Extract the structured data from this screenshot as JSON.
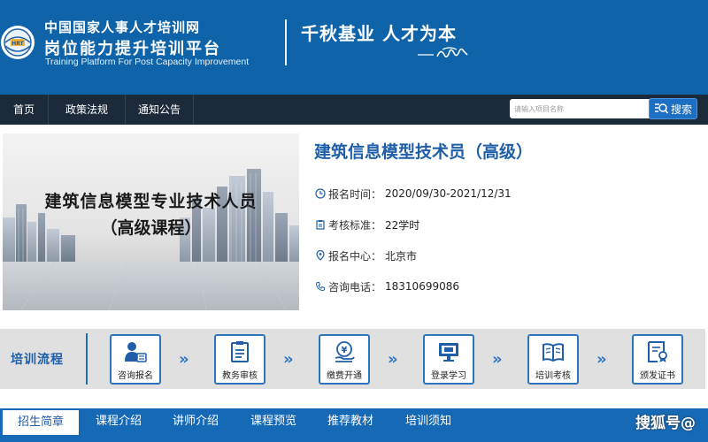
{
  "header": {
    "org_name": "中国国家人事人才培训网",
    "platform_name": "岗位能力提升培训平台",
    "platform_name_en": "Training Platform For Post Capacity Improvement",
    "slogan": "千秋基业  人才为本"
  },
  "nav": {
    "items": [
      {
        "label": "首页"
      },
      {
        "label": "政策法规"
      },
      {
        "label": "通知公告"
      }
    ]
  },
  "search": {
    "placeholder": "请输入项目名称",
    "button_label": "搜索"
  },
  "banner": {
    "line1": "建筑信息模型专业技术人员",
    "line2": "（高级课程）"
  },
  "course": {
    "title": "建筑信息模型技术员（高级）",
    "info": [
      {
        "icon": "clock-icon",
        "label": "报名时间：",
        "value": "2020/09/30-2021/12/31"
      },
      {
        "icon": "clipboard-icon",
        "label": "考核标准：",
        "value": "22学时"
      },
      {
        "icon": "location-icon",
        "label": "报名中心：",
        "value": "北京市"
      },
      {
        "icon": "phone-icon",
        "label": "咨询电话：",
        "value": "18310699086"
      }
    ]
  },
  "process": {
    "title": "培训流程",
    "steps": [
      {
        "icon": "user-card-icon",
        "label": "咨询报名"
      },
      {
        "icon": "document-review-icon",
        "label": "教务审核"
      },
      {
        "icon": "yuan-payment-icon",
        "label": "缴费开通"
      },
      {
        "icon": "monitor-icon",
        "label": "登录学习"
      },
      {
        "icon": "book-icon",
        "label": "培训考核"
      },
      {
        "icon": "certificate-icon",
        "label": "颁发证书"
      }
    ]
  },
  "tabs": {
    "items": [
      {
        "label": "招生简章",
        "active": true
      },
      {
        "label": "课程介绍",
        "active": false
      },
      {
        "label": "讲师介绍",
        "active": false
      },
      {
        "label": "课程预览",
        "active": false
      },
      {
        "label": "推荐教材",
        "active": false
      },
      {
        "label": "培训须知",
        "active": false
      }
    ]
  },
  "watermark": "搜狐号@",
  "colors": {
    "header_blue": "#0f63a8",
    "nav_dark": "#1c2b3b",
    "accent_blue": "#1f5ea8",
    "tab_bar": "#1569b5"
  }
}
